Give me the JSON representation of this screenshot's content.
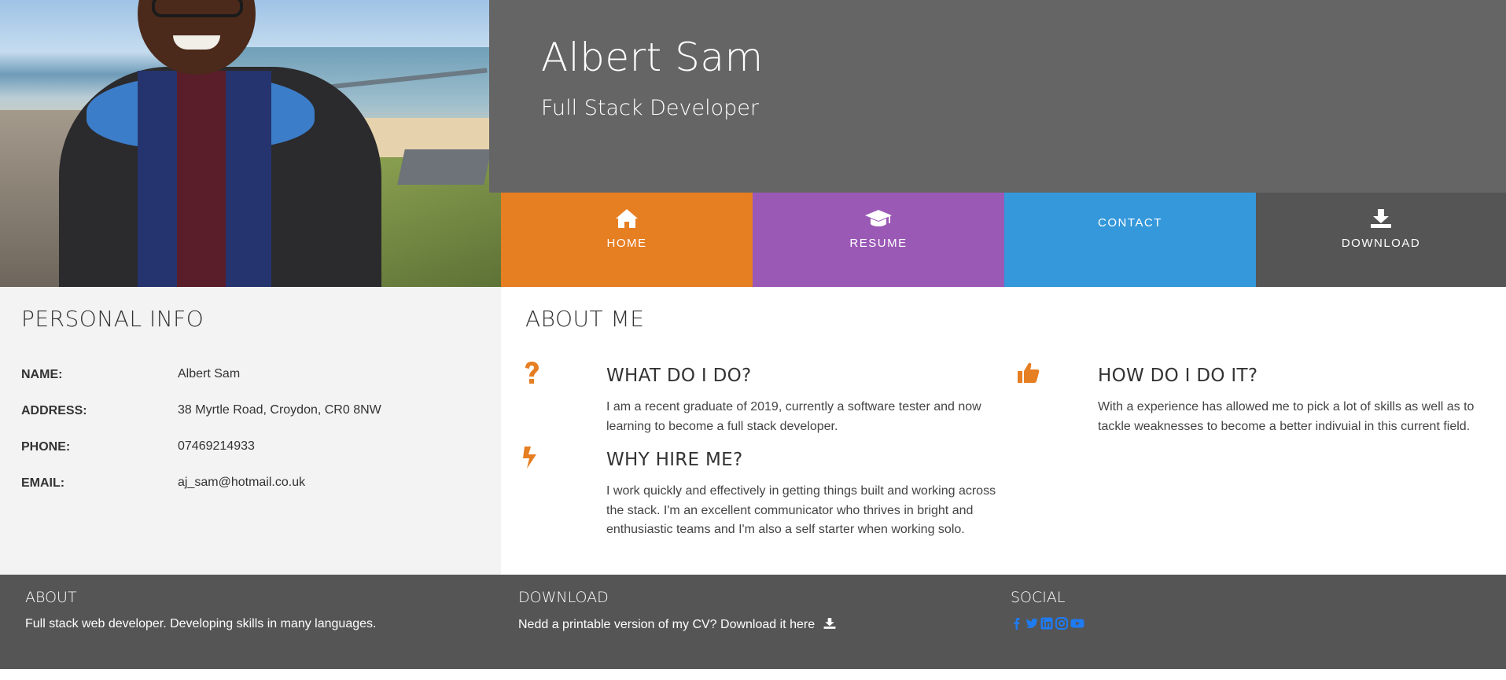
{
  "header": {
    "name": "Albert Sam",
    "role": "Full Stack Developer"
  },
  "nav": {
    "home": "HOME",
    "resume": "RESUME",
    "contact": "CONTACT",
    "download": "DOWNLOAD",
    "colors": {
      "home": "#e67e22",
      "resume": "#9b59b6",
      "contact": "#3498db",
      "download": "#555555"
    },
    "icons": {
      "home": "home-icon",
      "resume": "graduation-cap-icon",
      "download": "download-icon"
    }
  },
  "personal": {
    "title": "PERSONAL INFO",
    "rows": [
      {
        "label": "NAME:",
        "value": "Albert Sam"
      },
      {
        "label": "ADDRESS:",
        "value": "38 Myrtle Road, Croydon, CR0 8NW"
      },
      {
        "label": "PHONE:",
        "value": "07469214933"
      },
      {
        "label": "EMAIL:",
        "value": "aj_sam@hotmail.co.uk"
      }
    ]
  },
  "about": {
    "title": "ABOUT ME",
    "accent": "#e67e22",
    "features": [
      {
        "icon": "question-icon",
        "heading": "WHAT DO I DO?",
        "text": "I am a recent graduate of 2019, currently a software tester and now learning to become a full stack developer."
      },
      {
        "icon": "thumbs-up-icon",
        "heading": "HOW DO I DO IT?",
        "text": "With a experience has allowed me to pick a lot of skills as well as to tackle weaknesses to become a better indivuial in this current field."
      },
      {
        "icon": "bolt-icon",
        "heading": "WHY HIRE ME?",
        "text": "I work quickly and effectively in getting things built and working across the stack. I'm an excellent communicator who thrives in bright and enthusiastic teams and I'm also a self starter when working solo."
      }
    ]
  },
  "footer": {
    "about_title": "ABOUT",
    "about_text": "Full stack web developer. Developing skills in many languages.",
    "download_title": "DOWNLOAD",
    "download_text": "Nedd a printable version of my CV? Download it here",
    "social_title": "SOCIAL",
    "social_icons": [
      "facebook-icon",
      "twitter-icon",
      "linkedin-icon",
      "instagram-icon",
      "youtube-icon"
    ],
    "social_color": "#1e7bf2"
  }
}
